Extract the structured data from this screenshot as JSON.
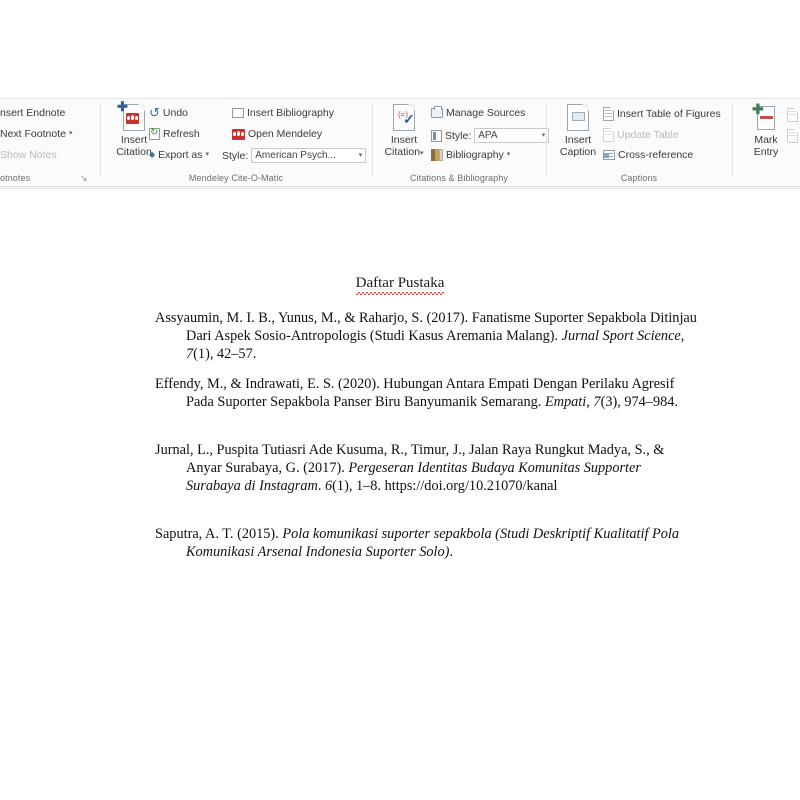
{
  "app": {
    "name": "Microsoft Word",
    "ribbon_tab": "References"
  },
  "ribbon": {
    "groups": [
      {
        "id": "footnotes",
        "title": "otnotes",
        "full_title": "Footnotes",
        "items": [
          {
            "label": "nsert Endnote",
            "full_label": "Insert Endnote",
            "disabled": false
          },
          {
            "label": "Next Footnote",
            "full_label": "Next Footnote",
            "disabled": false,
            "caret": "▾"
          },
          {
            "label": "Show Notes",
            "full_label": "Show Notes",
            "disabled": true
          }
        ],
        "dialog_launcher": "↘"
      },
      {
        "id": "mendeley",
        "title": "Mendeley Cite-O-Matic",
        "big_button": {
          "line1": "Insert",
          "line2": "Citation",
          "icon": "insert-citation-mendeley-icon"
        },
        "items": [
          {
            "label": "Undo",
            "icon": "undo-icon"
          },
          {
            "label": "Refresh",
            "icon": "refresh-icon"
          },
          {
            "label": "Insert Bibliography",
            "icon": "insert-bibliography-icon"
          },
          {
            "label": "Open Mendeley",
            "icon": "mendeley-logo-icon"
          },
          {
            "label": "Export as",
            "icon": "export-as-icon",
            "caret": "▾"
          }
        ],
        "style": {
          "label": "Style:",
          "value": "American Psych...",
          "caret": "▾"
        }
      },
      {
        "id": "citations",
        "title": "Citations & Bibliography",
        "big_button": {
          "line1": "Insert",
          "line2": "Citation",
          "caret": "▾",
          "icon": "insert-citation-icon"
        },
        "items": [
          {
            "label": "Manage Sources",
            "icon": "manage-sources-icon"
          },
          {
            "label": "Bibliography",
            "icon": "bibliography-icon",
            "caret": "▾"
          }
        ],
        "style": {
          "label": "Style:",
          "value": "APA",
          "caret": "▾"
        }
      },
      {
        "id": "captions",
        "title": "Captions",
        "big_button": {
          "line1": "Insert",
          "line2": "Caption",
          "icon": "insert-caption-icon"
        },
        "items": [
          {
            "label": "Insert Table of Figures",
            "icon": "insert-table-of-figures-icon",
            "disabled": false
          },
          {
            "label": "Update Table",
            "icon": "update-table-icon",
            "disabled": true
          },
          {
            "label": "Cross-reference",
            "icon": "cross-reference-icon",
            "disabled": false
          }
        ]
      },
      {
        "id": "index",
        "title": "",
        "big_button": {
          "line1": "Mark",
          "line2": "Entry",
          "icon": "mark-entry-icon"
        }
      }
    ]
  },
  "document": {
    "heading": "Daftar Pustaka",
    "heading_spellcheck": true,
    "references": [
      {
        "id": "ref-1",
        "parts": [
          {
            "text": "Assyaumin, M. I. B., Yunus, M., & Raharjo, S. (2017). Fanatisme Suporter Sepakbola Ditinjau Dari Aspek Sosio-Antropologis (Studi Kasus Aremania Malang). ",
            "italic": false
          },
          {
            "text": "Jurnal Sport Science",
            "italic": true
          },
          {
            "text": ", ",
            "italic": false
          },
          {
            "text": "7",
            "italic": true
          },
          {
            "text": "(1), 42–57.",
            "italic": false
          }
        ]
      },
      {
        "id": "ref-2",
        "parts": [
          {
            "text": "Effendy, M., & Indrawati, E. S. (2020). Hubungan Antara Empati Dengan Perilaku Agresif Pada Suporter Sepakbola Panser Biru Banyumanik Semarang. ",
            "italic": false
          },
          {
            "text": "Empati",
            "italic": true
          },
          {
            "text": ", ",
            "italic": false
          },
          {
            "text": "7",
            "italic": true
          },
          {
            "text": "(3), 974–984.",
            "italic": false
          }
        ]
      },
      {
        "id": "ref-3",
        "parts": [
          {
            "text": "Jurnal, L., Puspita Tutiasri Ade Kusuma, R., Timur, J., Jalan Raya Rungkut Madya, S., & Anyar Surabaya, G. (2017). ",
            "italic": false
          },
          {
            "text": "Pergeseran Identitas Budaya Komunitas Supporter Surabaya di Instagram",
            "italic": true
          },
          {
            "text": ". ",
            "italic": false
          },
          {
            "text": "6",
            "italic": true
          },
          {
            "text": "(1), 1–8. https://doi.org/10.21070/kanal",
            "italic": false
          }
        ]
      },
      {
        "id": "ref-4",
        "parts": [
          {
            "text": "Saputra, A. T. (2015). ",
            "italic": false
          },
          {
            "text": "Pola komunikasi suporter sepakbola (Studi Deskriptif Kualitatif Pola Komunikasi Arsenal Indonesia Suporter Solo)",
            "italic": true
          },
          {
            "text": ".",
            "italic": false
          }
        ]
      }
    ]
  },
  "colors": {
    "mendeley_red": "#c8322e",
    "spellcheck_red": "#d24a43",
    "ribbon_background": "#fbfbfb",
    "document_background": "#ffffff",
    "text": "#111111"
  }
}
